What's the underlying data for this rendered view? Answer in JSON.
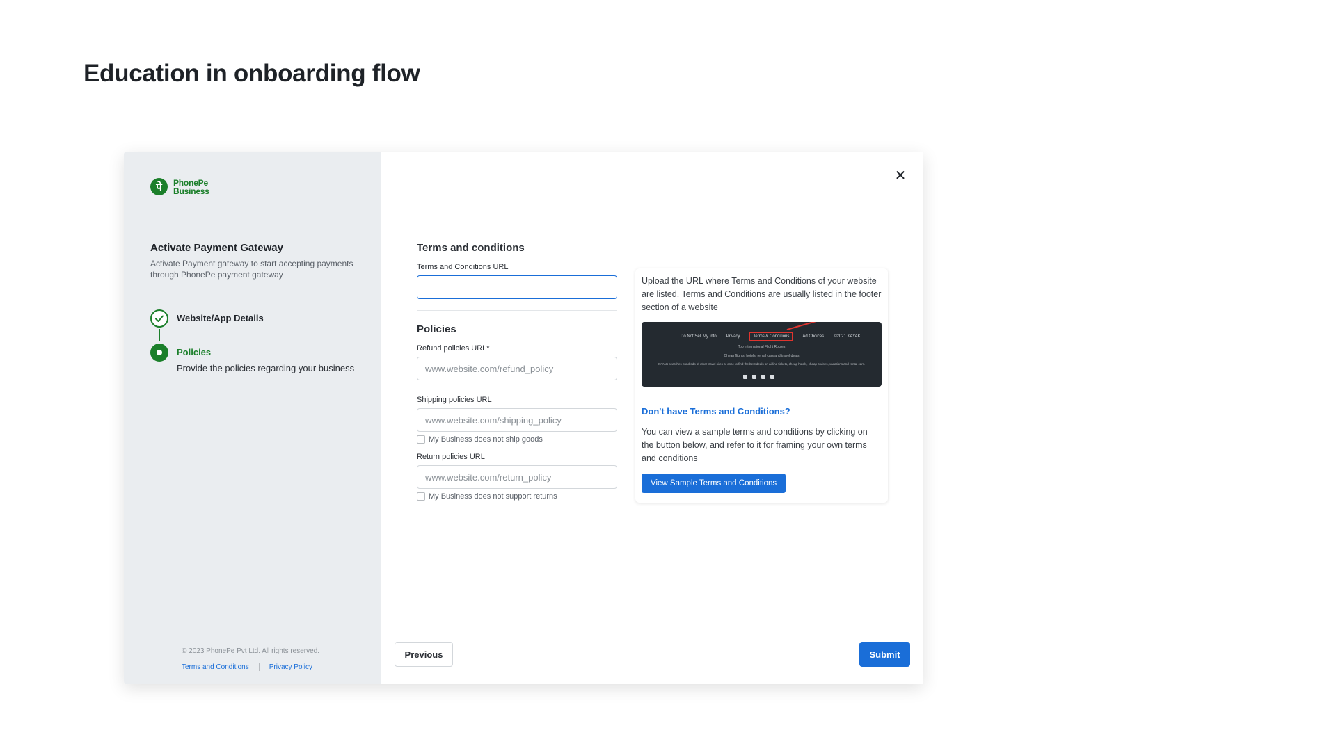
{
  "page": {
    "title": "Education in onboarding flow"
  },
  "sidebar": {
    "logo_line1": "PhonePe",
    "logo_line2": "Business",
    "title": "Activate Payment Gateway",
    "description": "Activate Payment gateway to start accepting payments through PhonePe payment gateway",
    "steps": [
      {
        "label": "Website/App Details",
        "status": "done",
        "subtitle": ""
      },
      {
        "label": "Policies",
        "status": "active",
        "subtitle": "Provide the policies regarding your business"
      }
    ],
    "copyright": "© 2023 PhonePe Pvt Ltd. All rights reserved.",
    "links": [
      "Terms and Conditions",
      "Privacy Policy"
    ]
  },
  "form": {
    "tc_section": "Terms and conditions",
    "tc_label": "Terms and Conditions URL",
    "tc_value": "",
    "policies_section": "Policies",
    "refund_label": "Refund policies URL*",
    "refund_placeholder": "www.website.com/refund_policy",
    "shipping_label": "Shipping policies URL",
    "shipping_placeholder": "www.website.com/shipping_policy",
    "shipping_check": "My Business does not ship goods",
    "return_label": "Return policies URL",
    "return_placeholder": "www.website.com/return_policy",
    "return_check": "My Business does not support returns"
  },
  "help": {
    "intro": "Upload the URL where Terms and Conditions of your website are listed. Terms and Conditions are usually listed in the footer section of a website",
    "preview_links": [
      "Do Not Sell My Info",
      "Privacy",
      "Terms & Conditions",
      "Ad Choices",
      "©2021 KAYAK"
    ],
    "preview_line2": "Top International Flight Routes",
    "preview_line3": "Cheap flights, hotels, rental cars and travel deals",
    "preview_line4": "KAYAK searches hundreds of other travel sites at once to find the best deals on airline tickets, cheap hotels, cheap cruises, vacations and rental cars.",
    "link_title": "Don't have Terms and Conditions?",
    "body": "You can view a sample terms and conditions by clicking on the button below, and refer to it for framing your own terms and conditions",
    "button": "View Sample Terms and Conditions"
  },
  "footer": {
    "previous": "Previous",
    "submit": "Submit"
  },
  "colors": {
    "brand_green": "#1b7f2a",
    "accent_blue": "#1a6ed8"
  },
  "icons": {
    "close": "close-icon",
    "check": "check-icon",
    "logo": "phonepe-logo-icon"
  }
}
